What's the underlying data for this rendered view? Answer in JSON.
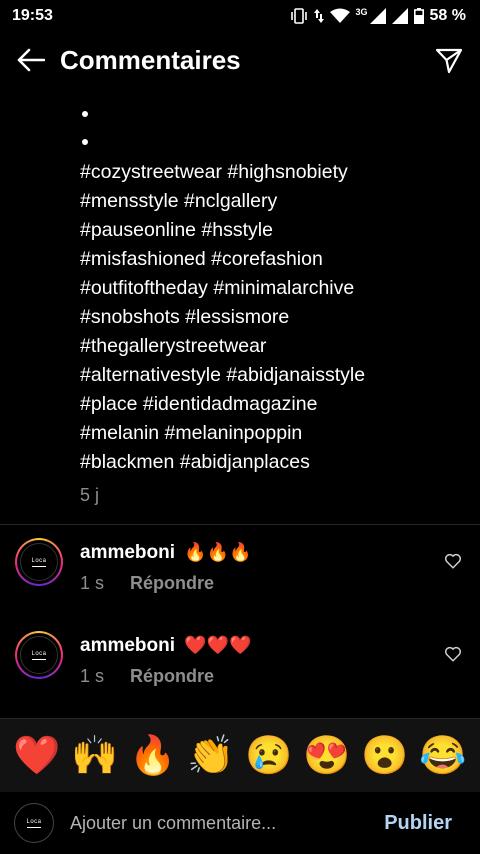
{
  "status_bar": {
    "time": "19:53",
    "network": "3G",
    "battery": "58 %"
  },
  "header": {
    "title": "Commentaires",
    "back_icon": "arrow-left-icon",
    "send_icon": "paper-plane-icon"
  },
  "caption": {
    "hashtag_lines": [
      "#cozystreetwear #highsnobiety",
      "#mensstyle #nclgallery",
      "#pauseonline #hsstyle",
      "#misfashioned #corefashion",
      "#outfitoftheday #minimalarchive",
      "#snobshots #lessismore",
      "#thegallerystreetwear",
      "#alternativestyle #abidjanaisstyle",
      "#place #identidadmagazine",
      "#melanin #melaninpoppin",
      "#blackmen #abidjanplaces"
    ],
    "time": "5 j"
  },
  "comments": [
    {
      "username": "ammeboni",
      "text": "🔥🔥🔥",
      "time": "1 s",
      "reply_label": "Répondre"
    },
    {
      "username": "ammeboni",
      "text": "❤️❤️❤️",
      "time": "1 s",
      "reply_label": "Répondre"
    }
  ],
  "emoji_bar": [
    "❤️",
    "🙌",
    "🔥",
    "👏",
    "😢",
    "😍",
    "😮",
    "😂"
  ],
  "composer": {
    "placeholder": "Ajouter un commentaire...",
    "publish_label": "Publier"
  },
  "colors": {
    "background": "#000000",
    "secondary_text": "#8e8e8e",
    "publish": "#b4d4f3"
  }
}
